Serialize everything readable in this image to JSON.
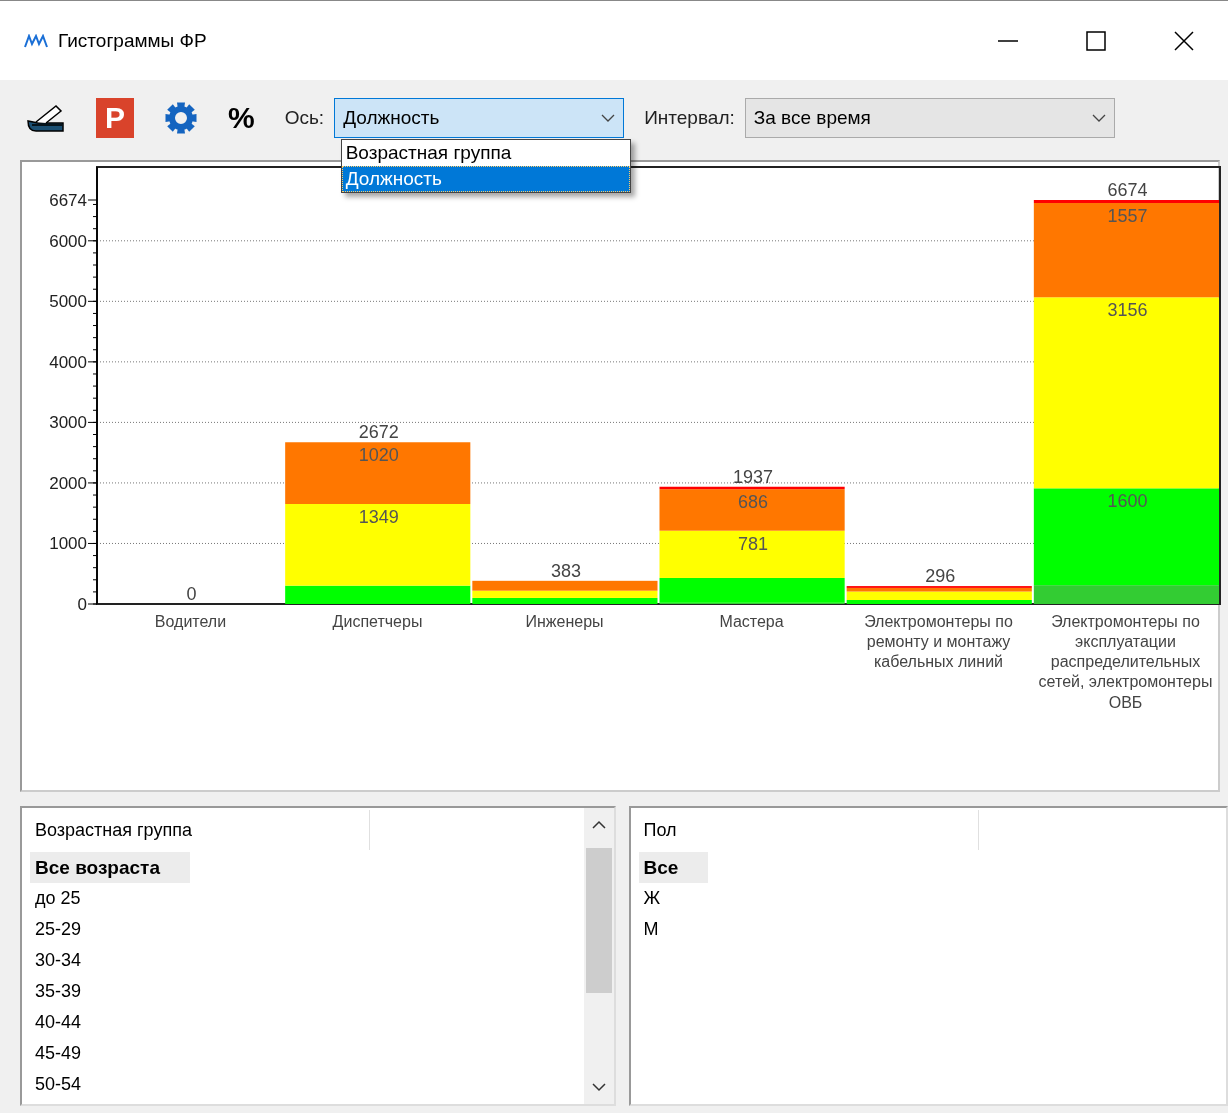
{
  "window": {
    "title": "Гистограммы ФР"
  },
  "toolbar_buttons": [
    {
      "kind": "scanner"
    },
    {
      "kind": "report",
      "text": "P"
    },
    {
      "kind": "settings"
    },
    {
      "kind": "percent",
      "text": "%"
    }
  ],
  "axis_selector": {
    "label": "Ось:",
    "value": "Должность",
    "open": true,
    "options": [
      {
        "label": "Возрастная группа",
        "selected": false
      },
      {
        "label": "Должность",
        "selected": true
      }
    ]
  },
  "interval_selector": {
    "label": "Интервал:",
    "value": "За все время"
  },
  "chart": {
    "chart_data": {
      "type": "bar",
      "stacked": true,
      "orientation": "vertical",
      "grid": true,
      "categories": [
        "Водители",
        "Диспетчеры",
        "Инженеры",
        "Мастера",
        "Электромонтеры по ремонту и монтажу кабельных линий",
        "Электромонтеры по эксплуатации распределительных сетей, электромонтеры ОВБ"
      ],
      "ylim": [
        0,
        6674
      ],
      "yticks": [
        0,
        1000,
        2000,
        3000,
        4000,
        5000,
        6000,
        {
          "value": 6674,
          "label": "6674"
        }
      ],
      "series": [
        {
          "color": "#33cc33",
          "values": [
            0,
            0,
            0,
            20,
            0,
            311
          ]
        },
        {
          "color": "#00ff00",
          "values": [
            0,
            303,
            100,
            410,
            66,
            1600
          ]
        },
        {
          "color": "#ffff00",
          "values": [
            0,
            1349,
            120,
            781,
            140,
            3156
          ]
        },
        {
          "color": "#ff7700",
          "values": [
            0,
            1020,
            163,
            686,
            60,
            1557
          ]
        },
        {
          "color": "#ff0000",
          "values": [
            0,
            0,
            0,
            40,
            30,
            50
          ]
        }
      ],
      "value_labels": [
        [
          null,
          null,
          null,
          null,
          null,
          null
        ],
        [
          null,
          null,
          null,
          null,
          null,
          "1600"
        ],
        [
          null,
          "1349",
          null,
          "781",
          null,
          "3156"
        ],
        [
          null,
          "1020",
          null,
          "686",
          null,
          "1557"
        ],
        [
          null,
          null,
          null,
          null,
          null,
          null
        ]
      ],
      "annotations": [
        "0",
        "2672",
        "383",
        "1937",
        "296",
        "6674"
      ]
    }
  },
  "age_list": {
    "column": "Возрастная группа",
    "rows": [
      {
        "label": "Все возраста",
        "selected": true
      },
      {
        "label": "до 25",
        "selected": false
      },
      {
        "label": "25-29",
        "selected": false
      },
      {
        "label": "30-34",
        "selected": false
      },
      {
        "label": "35-39",
        "selected": false
      },
      {
        "label": "40-44",
        "selected": false
      },
      {
        "label": "45-49",
        "selected": false
      },
      {
        "label": "50-54",
        "selected": false
      }
    ]
  },
  "sex_list": {
    "column": "Пол",
    "rows": [
      {
        "label": "Все",
        "selected": true
      },
      {
        "label": "Ж",
        "selected": false
      },
      {
        "label": "М",
        "selected": false
      }
    ]
  }
}
